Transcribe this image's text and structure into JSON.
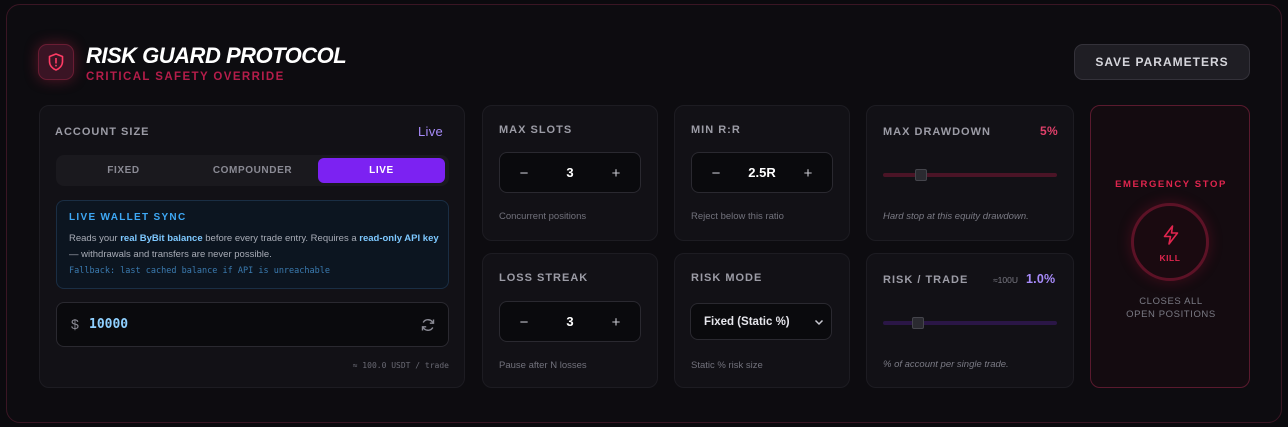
{
  "header": {
    "icon": "shield-alert-icon",
    "title": "RISK GUARD PROTOCOL",
    "subtitle": "CRITICAL SAFETY OVERRIDE",
    "save_label": "SAVE PARAMETERS"
  },
  "account": {
    "label": "ACCOUNT SIZE",
    "mode_value": "Live",
    "modes": [
      {
        "label": "FIXED",
        "active": false
      },
      {
        "label": "COMPOUNDER",
        "active": false
      },
      {
        "label": "LIVE",
        "active": true
      }
    ],
    "sync": {
      "title": "LIVE WALLET SYNC",
      "body_1": "Reads your ",
      "body_2": "real ByBit balance",
      "body_3": " before every trade entry. Requires a ",
      "body_4": "read-only API key",
      "body_5": " — withdrawals and transfers are never possible.",
      "fallback": "Fallback: last cached balance if API is unreachable"
    },
    "currency": "$",
    "amount": "10000",
    "per_trade": "≈ 100.0 USDT / trade"
  },
  "max_slots": {
    "label": "MAX SLOTS",
    "value": "3",
    "minus": "−",
    "plus": "+",
    "hint": "Concurrent positions"
  },
  "min_rr": {
    "label": "MIN R:R",
    "value": "2.5R",
    "minus": "−",
    "plus": "+",
    "hint": "Reject below this ratio"
  },
  "loss_streak": {
    "label": "LOSS STREAK",
    "value": "3",
    "minus": "−",
    "plus": "+",
    "hint": "Pause after N losses"
  },
  "risk_mode": {
    "label": "RISK MODE",
    "selected": "Fixed (Static %)",
    "hint": "Static % risk size"
  },
  "max_drawdown": {
    "label": "MAX DRAWDOWN",
    "value": "5%",
    "slider_fraction": 0.22,
    "hint": "Hard stop at this equity drawdown.",
    "color": "#e0406a"
  },
  "risk_trade": {
    "label": "RISK / TRADE",
    "approx": "≈100U",
    "value": "1.0%",
    "slider_fraction": 0.2,
    "hint": "% of account per single trade.",
    "color": "#a78bfa"
  },
  "emergency": {
    "title": "EMERGENCY STOP",
    "kill_label": "KILL",
    "icon": "lightning-bolt-icon",
    "note_line1": "CLOSES ALL",
    "note_line2": "OPEN POSITIONS"
  }
}
